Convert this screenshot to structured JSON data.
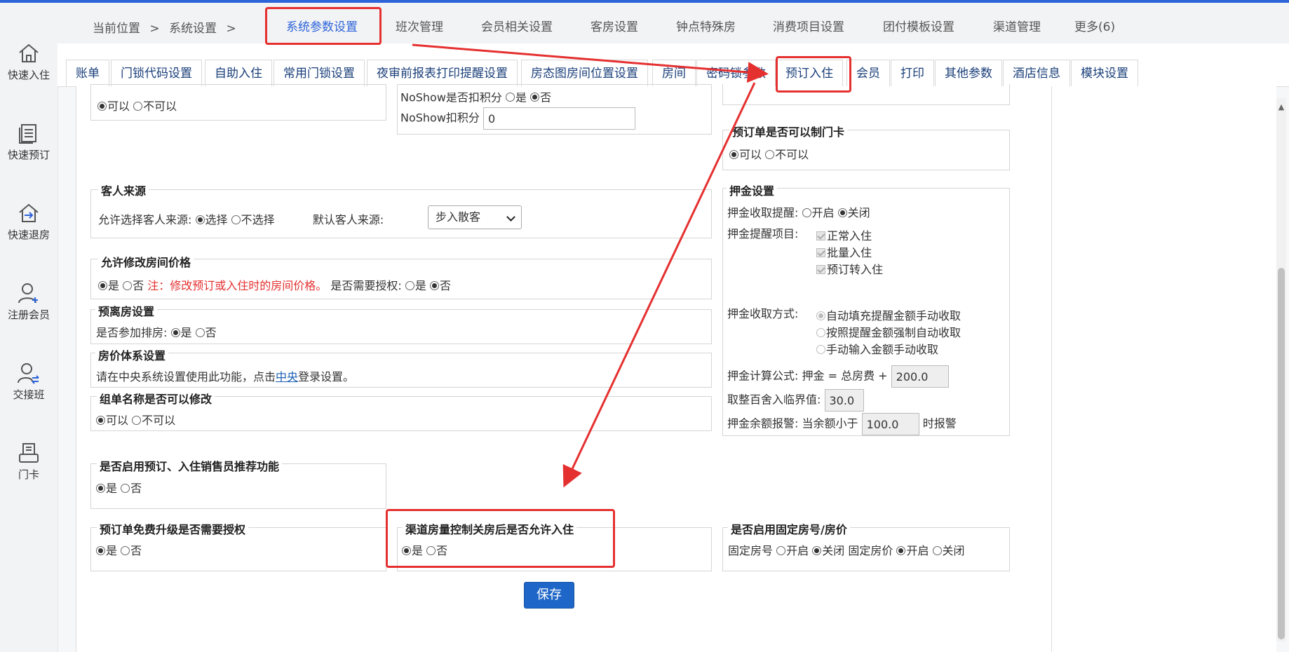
{
  "sidebar": {
    "items": [
      {
        "label": "快速入住",
        "icon": "home-icon"
      },
      {
        "label": "快速预订",
        "icon": "document-icon"
      },
      {
        "label": "快速退房",
        "icon": "checkout-house-icon"
      },
      {
        "label": "注册会员",
        "icon": "add-user-icon"
      },
      {
        "label": "交接班",
        "icon": "shift-handover-icon"
      },
      {
        "label": "门卡",
        "icon": "card-printer-icon"
      }
    ]
  },
  "header": {
    "crumb_location": "当前位置",
    "crumb_sep": ">",
    "crumb_system": "系统设置",
    "menu": [
      "系统参数设置",
      "班次管理",
      "会员相关设置",
      "客房设置",
      "钟点特殊房",
      "消费项目设置",
      "团付模板设置",
      "渠道管理",
      "更多(6)"
    ]
  },
  "tabs": [
    "账单",
    "门锁代码设置",
    "自助入住",
    "常用门锁设置",
    "夜审前报表打印提醒设置",
    "房态图房间位置设置",
    "房间",
    "密码锁参数",
    "预订入住",
    "会员",
    "打印",
    "其他参数",
    "酒店信息",
    "模块设置"
  ],
  "sections": {
    "top_left": {
      "opt_yes": "可以",
      "opt_no": "不可以"
    },
    "noshow": {
      "partial_label": "NoShow是否扣积分",
      "partial_yes": "是",
      "partial_no": "否",
      "label": "NoShow扣积分",
      "value": "0"
    },
    "card_make": {
      "title": "预订单是否可以制门卡",
      "opt_yes": "可以",
      "opt_no": "不可以"
    },
    "guest_source": {
      "title": "客人来源",
      "allow_label": "允许选择客人来源:",
      "opt_select": "选择",
      "opt_noselect": "不选择",
      "default_label": "默认客人来源:",
      "default_value": "步入散客"
    },
    "modify_price": {
      "title": "允许修改房间价格",
      "opt_yes": "是",
      "opt_no": "否",
      "note": "注：修改预订或入住时的房间价格。",
      "auth_label": "是否需要授权:",
      "auth_yes": "是",
      "auth_no": "否"
    },
    "pre_checkout": {
      "title": "预离房设置",
      "label": "是否参加排房:",
      "opt_yes": "是",
      "opt_no": "否"
    },
    "price_system": {
      "title": "房价体系设置",
      "text_before": "请在中央系统设置使用此功能，点击",
      "link": "中央",
      "text_after": "登录设置。"
    },
    "group_name": {
      "title": "组单名称是否可以修改",
      "opt_yes": "可以",
      "opt_no": "不可以"
    },
    "sales_recommend": {
      "title": "是否启用预订、入住销售员推荐功能",
      "opt_yes": "是",
      "opt_no": "否"
    },
    "free_upgrade": {
      "title": "预订单免费升级是否需要授权",
      "opt_yes": "是",
      "opt_no": "否"
    },
    "channel_close": {
      "title": "渠道房量控制关房后是否允许入住",
      "opt_yes": "是",
      "opt_no": "否"
    },
    "fixed_room": {
      "title": "是否启用固定房号/房价",
      "room_label": "固定房号",
      "price_label": "固定房价",
      "opt_on": "开启",
      "opt_off": "关闭"
    },
    "deposit": {
      "title": "押金设置",
      "remind_label": "押金收取提醒:",
      "opt_on": "开启",
      "opt_off": "关闭",
      "items_label": "押金提醒项目:",
      "items": [
        "正常入住",
        "批量入住",
        "预订转入住"
      ],
      "method_label": "押金收取方式:",
      "methods": [
        "自动填充提醒金额手动收取",
        "按照提醒金额强制自动收取",
        "手动输入金额手动收取"
      ],
      "formula_label": "押金计算公式:",
      "formula_text": "押金 = 总房费 +",
      "formula_value": "200.0",
      "round_label": "取整百舍入临界值:",
      "round_value": "30.0",
      "alarm_label": "押金余额报警:",
      "alarm_text": "当余额小于",
      "alarm_value": "100.0",
      "alarm_suffix": "时报警"
    }
  },
  "save_label": "保存",
  "colors": {
    "accent": "#2d64d9",
    "annotation": "#e53030",
    "save": "#1e66c8"
  }
}
